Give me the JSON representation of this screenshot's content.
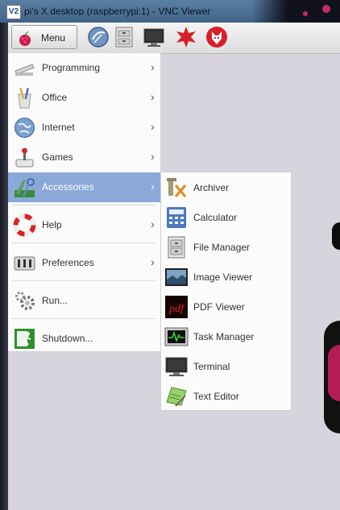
{
  "window": {
    "title": "pi's X desktop (raspberrypi:1) - VNC Viewer",
    "app_icon_label": "V2"
  },
  "panel": {
    "menu_label": "Menu",
    "launchers": [
      "browser-icon",
      "file-manager-icon",
      "terminal-icon",
      "mathematica-icon",
      "wolfram-icon"
    ]
  },
  "main_menu": {
    "items": [
      {
        "label": "Programming",
        "icon": "programming-icon",
        "submenu": true
      },
      {
        "label": "Office",
        "icon": "office-icon",
        "submenu": true
      },
      {
        "label": "Internet",
        "icon": "internet-icon",
        "submenu": true
      },
      {
        "label": "Games",
        "icon": "games-icon",
        "submenu": true
      },
      {
        "label": "Accessories",
        "icon": "accessories-icon",
        "submenu": true,
        "active": true
      },
      {
        "label": "Help",
        "icon": "help-icon",
        "submenu": true
      },
      {
        "label": "Preferences",
        "icon": "preferences-icon",
        "submenu": true
      },
      {
        "label": "Run...",
        "icon": "run-icon",
        "submenu": false
      },
      {
        "label": "Shutdown...",
        "icon": "shutdown-icon",
        "submenu": false
      }
    ],
    "chevron": "›"
  },
  "accessories_menu": {
    "items": [
      {
        "label": "Archiver",
        "icon": "archiver-icon"
      },
      {
        "label": "Calculator",
        "icon": "calculator-icon"
      },
      {
        "label": "File Manager",
        "icon": "file-manager-icon"
      },
      {
        "label": "Image Viewer",
        "icon": "image-viewer-icon"
      },
      {
        "label": "PDF Viewer",
        "icon": "pdf-viewer-icon",
        "icon_text": "pdf"
      },
      {
        "label": "Task Manager",
        "icon": "task-manager-icon"
      },
      {
        "label": "Terminal",
        "icon": "terminal-icon"
      },
      {
        "label": "Text Editor",
        "icon": "text-editor-icon"
      }
    ]
  },
  "colors": {
    "menu_highlight": "#8aa9d9",
    "desktop": "#d8d4dd",
    "titlebar": "#4a6f94"
  }
}
